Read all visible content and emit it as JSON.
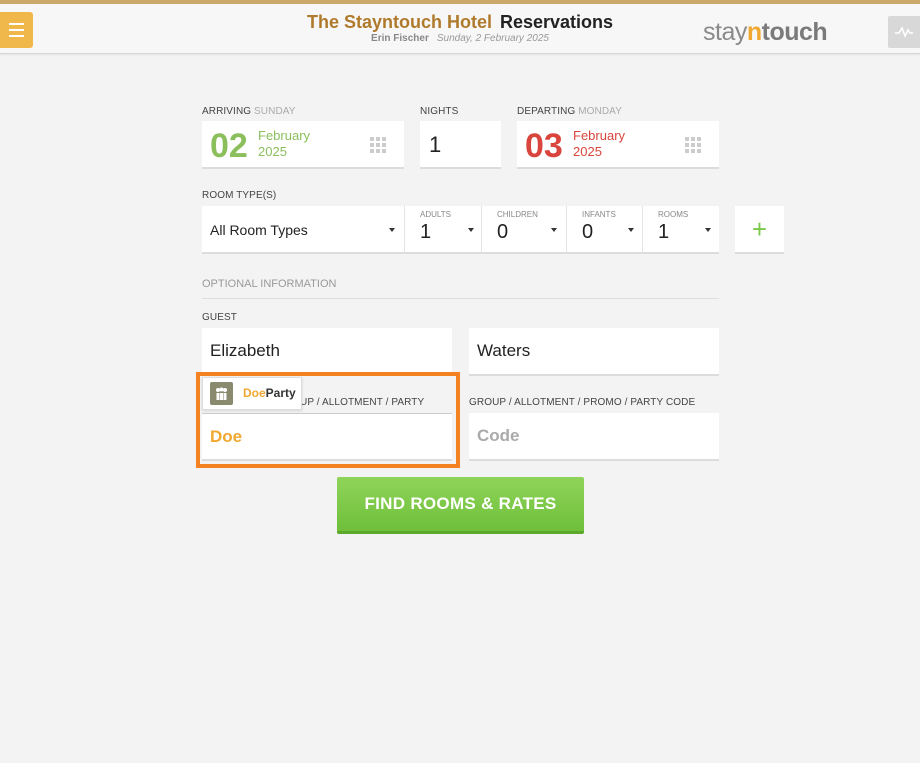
{
  "header": {
    "hotel_name": "The Stayntouch Hotel",
    "section": "Reservations",
    "user": "Erin Fischer",
    "date": "Sunday, 2 February 2025",
    "brand_pre": "stay",
    "brand_n": "n",
    "brand_post": "touch",
    "menu_icon": "hamburger-icon",
    "chart_icon": "activity-chart-icon"
  },
  "arriving": {
    "label": "ARRIVING",
    "weekday": "SUNDAY",
    "day": "02",
    "month": "February",
    "year": "2025"
  },
  "nights": {
    "label": "NIGHTS",
    "value": "1"
  },
  "departing": {
    "label": "DEPARTING",
    "weekday": "MONDAY",
    "day": "03",
    "month": "February",
    "year": "2025"
  },
  "room": {
    "label": "ROOM TYPE(S)",
    "type_value": "All Room Types",
    "adults_label": "ADULTS",
    "adults": "1",
    "children_label": "CHILDREN",
    "children": "0",
    "infants_label": "INFANTS",
    "infants": "0",
    "rooms_label": "ROOMS",
    "rooms": "1",
    "add_symbol": "+"
  },
  "optional": {
    "title": "OPTIONAL INFORMATION",
    "guest_label": "GUEST",
    "first_name": "Elizabeth",
    "last_name": "Waters",
    "company_label_partial": "UP / ALLOTMENT / PARTY",
    "company_value": "Doe",
    "group_label": "GROUP / ALLOTMENT / PROMO / PARTY CODE",
    "group_placeholder": "Code"
  },
  "suggestion": {
    "match": "Doe",
    "rest": "Party"
  },
  "actions": {
    "find_label": "FIND ROOMS & RATES"
  },
  "colors": {
    "accent": "#f0a830",
    "arrive": "#8bbf5c",
    "depart": "#d9453c",
    "highlight": "#f58220",
    "button": "#7cc94a"
  }
}
